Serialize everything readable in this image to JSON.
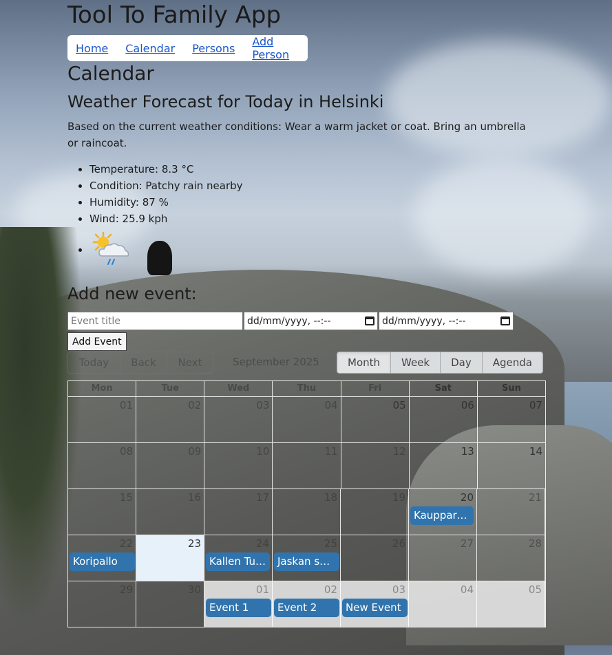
{
  "app": {
    "title": "Tool To Family App"
  },
  "nav": {
    "items": [
      {
        "label": "Home"
      },
      {
        "label": "Calendar"
      },
      {
        "label": "Persons"
      },
      {
        "label": "Add Person"
      }
    ]
  },
  "page": {
    "title": "Calendar"
  },
  "weather": {
    "title": "Weather Forecast for Today in Helsinki",
    "advice": "Based on the current weather conditions: Wear a warm jacket or coat. Bring an umbrella or raincoat.",
    "items": [
      "Temperature: 8.3 °C",
      "Condition: Patchy rain nearby",
      "Humidity: 87 %",
      "Wind: 25.9 kph"
    ],
    "icon": "sun-cloud-rain-icon"
  },
  "add_event": {
    "title": "Add new event:",
    "title_placeholder": "Event title",
    "start_value": "dd/mm/yyyy, --:--",
    "end_value": "dd/mm/yyyy, --:--",
    "button_label": "Add Event"
  },
  "calendar": {
    "nav_buttons": [
      "Today",
      "Back",
      "Next"
    ],
    "month_label": "September 2025",
    "views": [
      "Month",
      "Week",
      "Day",
      "Agenda"
    ],
    "active_view": "Month",
    "weekdays": [
      "Mon",
      "Tue",
      "Wed",
      "Thu",
      "Fri",
      "Sat",
      "Sun"
    ],
    "weeks": [
      [
        "01",
        "02",
        "03",
        "04",
        "05",
        "06",
        "07"
      ],
      [
        "08",
        "09",
        "10",
        "11",
        "12",
        "13",
        "14"
      ],
      [
        "15",
        "16",
        "17",
        "18",
        "19",
        "20",
        "21"
      ],
      [
        "22",
        "23",
        "24",
        "25",
        "26",
        "27",
        "28"
      ],
      [
        "29",
        "30",
        "01",
        "02",
        "03",
        "04",
        "05"
      ]
    ],
    "events": {
      "kauppareissu": "Kauppareissu",
      "koripallo": "Koripallo",
      "kallen": "Kallen Tuntiliikunta",
      "jaskan": "Jaskan synttärit",
      "event1": "Event 1",
      "event2": "Event 2",
      "new_event": "New Event"
    },
    "event_color": "#3174ad",
    "today_color": "#eaf6ff"
  }
}
